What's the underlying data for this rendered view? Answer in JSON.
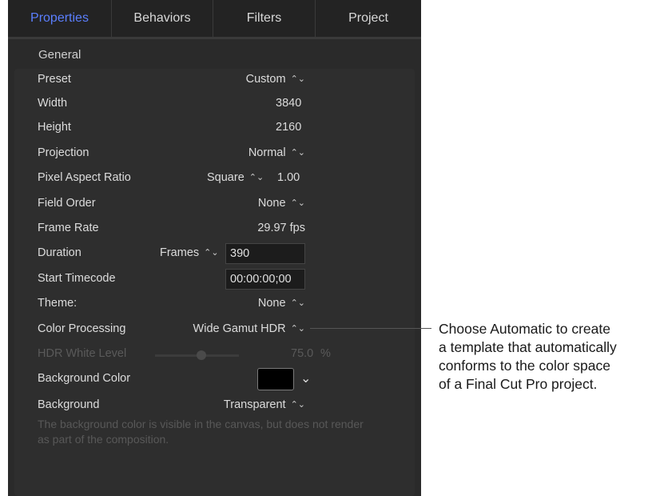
{
  "tabs": [
    {
      "label": "Properties",
      "active": true
    },
    {
      "label": "Behaviors",
      "active": false
    },
    {
      "label": "Filters",
      "active": false
    },
    {
      "label": "Project",
      "active": false
    }
  ],
  "section": {
    "title": "General"
  },
  "properties": {
    "preset": {
      "label": "Preset",
      "value": "Custom"
    },
    "width": {
      "label": "Width",
      "value": "3840"
    },
    "height": {
      "label": "Height",
      "value": "2160"
    },
    "projection": {
      "label": "Projection",
      "value": "Normal"
    },
    "pixel_aspect_ratio": {
      "label": "Pixel Aspect Ratio",
      "mode": "Square",
      "value": "1.00"
    },
    "field_order": {
      "label": "Field Order",
      "value": "None"
    },
    "frame_rate": {
      "label": "Frame Rate",
      "value": "29.97 fps"
    },
    "duration": {
      "label": "Duration",
      "unit": "Frames",
      "value": "390"
    },
    "start_timecode": {
      "label": "Start Timecode",
      "value": "00:00:00;00"
    },
    "theme": {
      "label": "Theme:",
      "value": "None"
    },
    "color_processing": {
      "label": "Color Processing",
      "value": "Wide Gamut HDR"
    },
    "hdr_white_level": {
      "label": "HDR White Level",
      "value": "75.0",
      "unit": "%",
      "slider_fraction": 0.55
    },
    "background_color": {
      "label": "Background Color",
      "color": "#000000"
    },
    "background": {
      "label": "Background",
      "value": "Transparent"
    }
  },
  "note": "The background color is visible in the canvas, but does not render as part of the composition.",
  "callout": {
    "lines": [
      "Choose Automatic to create",
      "a template that automatically",
      "conforms to the color space",
      "of a Final Cut Pro project."
    ]
  },
  "icons": {
    "updown": "updown-arrows-icon",
    "chevron": "chevron-down-icon"
  },
  "colors": {
    "accent": "#5b7fff",
    "panel": "#2a2a2a"
  }
}
